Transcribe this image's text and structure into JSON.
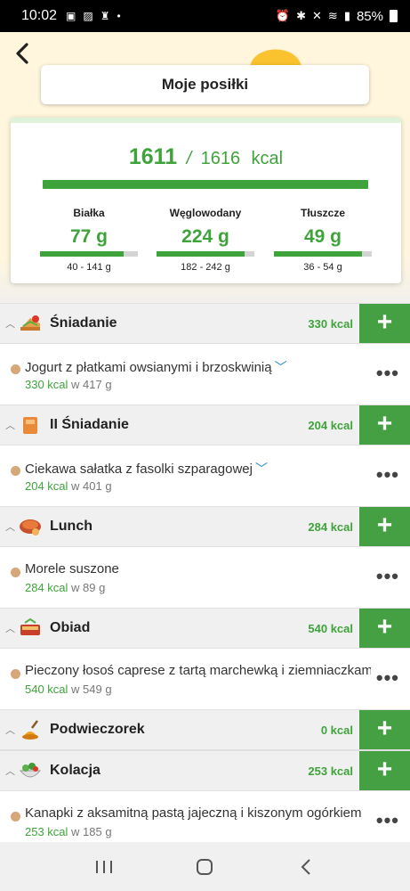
{
  "status": {
    "time": "10:02",
    "battery": "85%"
  },
  "header": {
    "title": "Moje posiłki"
  },
  "summary": {
    "eaten": "1611",
    "separator": "/",
    "goal": "1616",
    "unit": "kcal",
    "macros": [
      {
        "label": "Białka",
        "value": "77 g",
        "range": "40 - 141 g",
        "fill": 0.85
      },
      {
        "label": "Węglowodany",
        "value": "224 g",
        "range": "182 - 242 g",
        "fill": 0.9
      },
      {
        "label": "Tłuszcze",
        "value": "49 g",
        "range": "36 - 54 g",
        "fill": 0.9
      }
    ]
  },
  "meals": [
    {
      "name": "Śniadanie",
      "kcal": "330 kcal",
      "icon": "sandwich-icon",
      "item": {
        "name": "Jogurt z płatkami owsianymi i brzoskwinią",
        "kcal": "330 kcal",
        "weight": "w 417 g",
        "expandable": true
      }
    },
    {
      "name": "II Śniadanie",
      "kcal": "204 kcal",
      "icon": "lunchbox-icon",
      "item": {
        "name": "Ciekawa sałatka z fasolki szparagowej",
        "kcal": "204 kcal",
        "weight": "w 401 g",
        "expandable": true
      }
    },
    {
      "name": "Lunch",
      "kcal": "284 kcal",
      "icon": "bowl-icon",
      "item": {
        "name": "Morele suszone",
        "kcal": "284 kcal",
        "weight": "w 89 g",
        "expandable": false
      }
    },
    {
      "name": "Obiad",
      "kcal": "540 kcal",
      "icon": "lasagna-icon",
      "item": {
        "name": "Pieczony łosoś caprese z tartą marchewką i ziemniaczkami",
        "kcal": "540 kcal",
        "weight": "w 549 g",
        "expandable": false
      }
    },
    {
      "name": "Podwieczorek",
      "kcal": "0 kcal",
      "icon": "honey-icon",
      "item": null
    },
    {
      "name": "Kolacja",
      "kcal": "253 kcal",
      "icon": "salad-icon",
      "item": {
        "name": "Kanapki z aksamitną pastą jajeczną i kiszonym ogórkiem",
        "kcal": "253 kcal",
        "weight": "w 185 g",
        "expandable": false
      }
    }
  ],
  "colors": {
    "accent": "#44a043",
    "bullet": "#d5a779",
    "link": "#1e88c7"
  }
}
